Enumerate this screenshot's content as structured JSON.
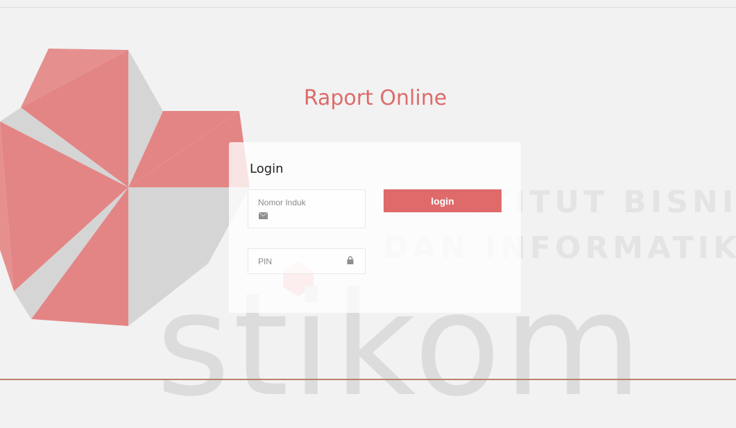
{
  "page": {
    "title": "Raport Online"
  },
  "login_card": {
    "heading": "Login",
    "nomor_induk": {
      "placeholder": "Nomor Induk",
      "value": ""
    },
    "pin": {
      "placeholder": "PIN",
      "value": ""
    },
    "submit_label": "login"
  },
  "watermark": {
    "line1": "INSTITUT BISNIS",
    "line2": "DAN INFORMATIKA",
    "word": "stikom"
  },
  "colors": {
    "accent": "#de6a6a",
    "title": "#dd6b6b",
    "background": "#f2f2f2",
    "logo_red": "#e27272",
    "logo_grey": "#d6d6d6",
    "bottom_border": "#b9826a"
  },
  "icons": {
    "nomor_induk": "envelope-icon",
    "pin": "lock-icon"
  }
}
